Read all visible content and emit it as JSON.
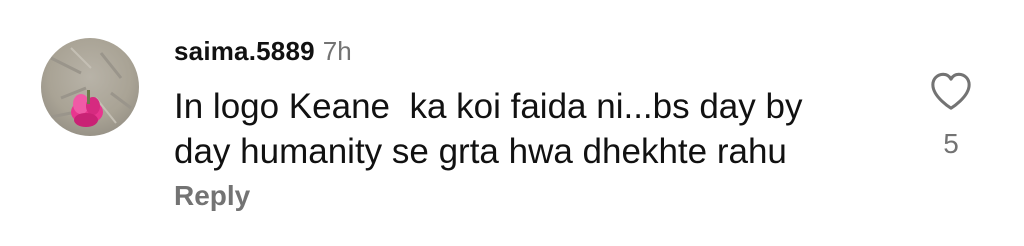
{
  "comment": {
    "username": "saima.5889",
    "time": "7h",
    "text_line1": "In logo Keane  ka koi faida ni...bs day by",
    "text_line2": "day humanity se grta hwa dhekhte rahu",
    "reply_label": "Reply",
    "like_count": "5",
    "icons": {
      "like": "heart-outline-icon",
      "avatar": "avatar-photo-pink-flower"
    },
    "colors": {
      "primary_text": "#111111",
      "secondary_text": "#737373",
      "avatar_flower": "#e8368f"
    }
  }
}
